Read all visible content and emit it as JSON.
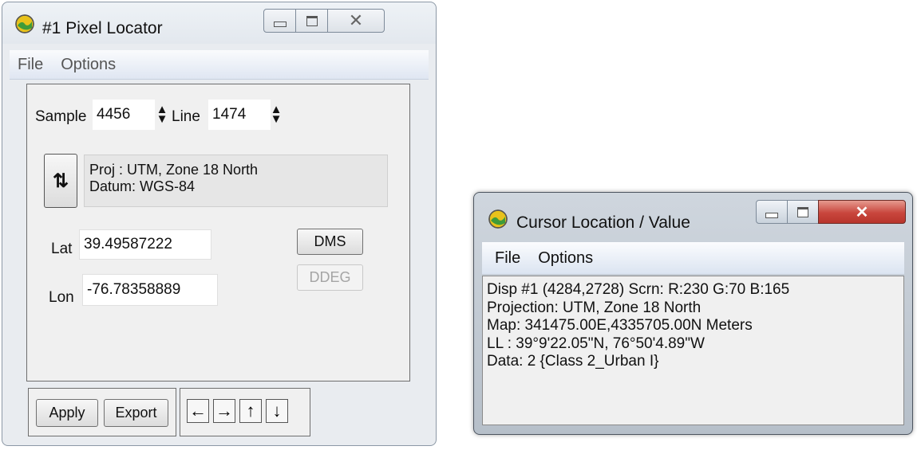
{
  "pixel_locator": {
    "title": "#1 Pixel Locator",
    "menu": [
      "File",
      "Options"
    ],
    "sample_label": "Sample",
    "sample_value": "4456",
    "line_label": "Line",
    "line_value": "1474",
    "proj_line1": "Proj : UTM, Zone 18 North",
    "proj_line2": "Datum: WGS-84",
    "lat_label": "Lat",
    "lat_value": "39.49587222",
    "lon_label": "Lon",
    "lon_value": "-76.78358889",
    "dms_label": "DMS",
    "ddeg_label": "DDEG",
    "apply_label": "Apply",
    "export_label": "Export",
    "swap_glyph": "⇅",
    "arrow_glyphs": [
      "←",
      "→",
      "↑",
      "↓"
    ],
    "window_controls": [
      "minimize-icon",
      "maximize-icon",
      "close-icon"
    ]
  },
  "cursor_window": {
    "title": "Cursor Location / Value",
    "menu": [
      "File",
      "Options"
    ],
    "lines": [
      "Disp #1 (4284,2728) Scrn: R:230 G:70 B:165",
      "Projection: UTM, Zone 18 North",
      "Map: 341475.00E,4335705.00N Meters",
      "LL : 39°9'22.05\"N, 76°50'4.89\"W",
      "Data: 2 {Class 2_Urban I}"
    ],
    "window_controls": [
      "minimize-icon",
      "maximize-icon",
      "close-icon"
    ]
  },
  "colors": {
    "close_button": "#c9463d",
    "app_icon_yellow": "#e8c21b",
    "app_icon_green": "#3e9b3a"
  }
}
